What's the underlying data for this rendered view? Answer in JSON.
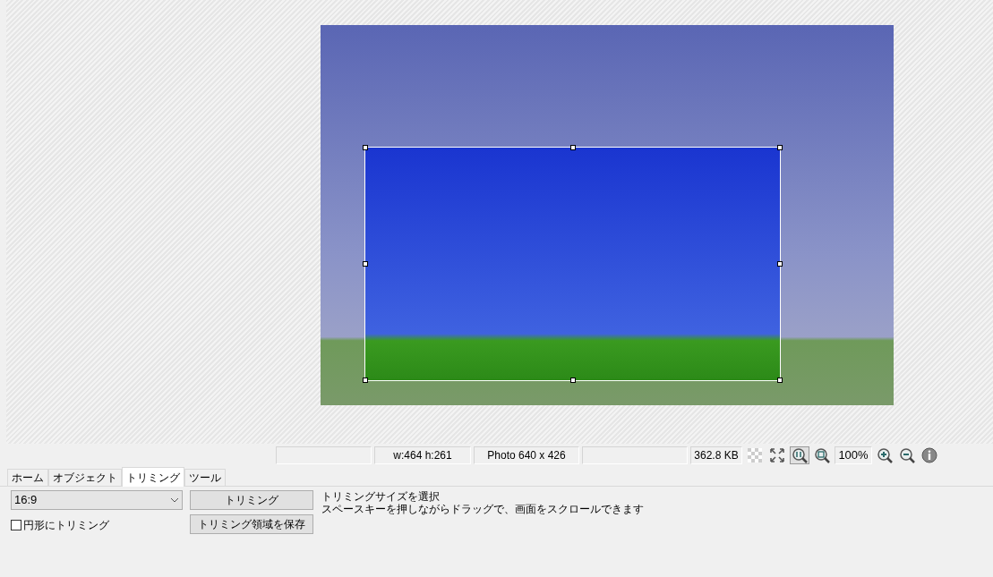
{
  "status_bar": {
    "selection_size": "w:464 h:261",
    "image_info": "Photo 640 x 426",
    "file_size": "362.8 KB",
    "tools": [
      {
        "kind": "transparency",
        "pressed": false
      },
      {
        "kind": "fit",
        "pressed": false
      },
      {
        "kind": "actual-size",
        "pressed": true
      },
      {
        "kind": "zoom-fit",
        "pressed": false
      }
    ],
    "zoom": "100%",
    "tools2": [
      {
        "kind": "zoom-in"
      },
      {
        "kind": "zoom-out"
      },
      {
        "kind": "info"
      }
    ]
  },
  "tabs": [
    {
      "label": "ホーム",
      "selected": false
    },
    {
      "label": "オブジェクト",
      "selected": false
    },
    {
      "label": "トリミング",
      "selected": true
    },
    {
      "label": "ツール",
      "selected": false
    }
  ],
  "panel": {
    "ratio": "16:9",
    "circle": {
      "label": "円形にトリミング",
      "checked": false
    },
    "buttons": [
      "トリミング",
      "トリミング領域を保存"
    ],
    "help": [
      "トリミングサイズを選択",
      "スペースキーを押しながらドラッグで、画面をスクロールできます"
    ]
  }
}
